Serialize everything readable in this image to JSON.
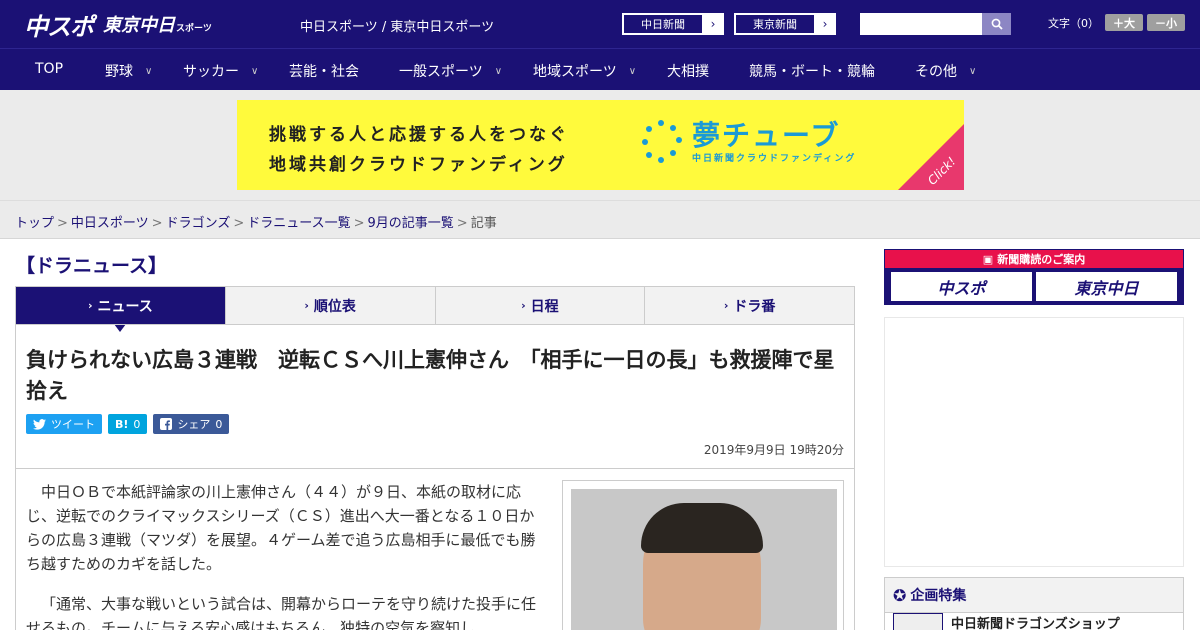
{
  "header": {
    "logo_main": "中スポ",
    "logo_tokyo": "東京中日",
    "logo_tokyo_small": "スポーツ",
    "site_links": "中日スポーツ / 東京中日スポーツ",
    "paper_buttons": [
      {
        "label": "中日新聞",
        "arrow": "›"
      },
      {
        "label": "東京新聞",
        "arrow": "›"
      }
    ],
    "search_placeholder": "",
    "fontsize_label": "文字（0）",
    "fontsize_up": "＋大",
    "fontsize_down": "－小"
  },
  "nav": {
    "items": [
      {
        "label": "TOP",
        "chev": ""
      },
      {
        "label": "野球",
        "chev": "∨"
      },
      {
        "label": "サッカー",
        "chev": "∨"
      },
      {
        "label": "芸能・社会",
        "chev": ""
      },
      {
        "label": "一般スポーツ",
        "chev": "∨"
      },
      {
        "label": "地域スポーツ",
        "chev": "∨"
      },
      {
        "label": "大相撲",
        "chev": ""
      },
      {
        "label": "競馬・ボート・競輪",
        "chev": ""
      },
      {
        "label": "その他",
        "chev": "∨"
      }
    ]
  },
  "banner": {
    "line1": "挑戦する人と応援する人をつなぐ",
    "line2": "地域共創クラウドファンディング",
    "brand": "夢チューブ",
    "brand_sub": "中日新聞クラウドファンディング",
    "click": "Click!"
  },
  "breadcrumb": {
    "items": [
      "トップ",
      "中日スポーツ",
      "ドラゴンズ",
      "ドラニュース一覧",
      "9月の記事一覧"
    ],
    "current": "記事",
    "sep": ">"
  },
  "main": {
    "section_title": "【ドラニュース】",
    "tabs": [
      {
        "label": "ニュース",
        "mark": "›"
      },
      {
        "label": "順位表",
        "mark": "›"
      },
      {
        "label": "日程",
        "mark": "›"
      },
      {
        "label": "ドラ番",
        "mark": "›"
      }
    ],
    "headline": "負けられない広島３連戦　逆転ＣＳへ川上憲伸さん　「相手に一日の長」も救援陣で星拾え",
    "social": {
      "tweet": "ツイート",
      "hatena": "B!",
      "hatena_count": "0",
      "share": "シェア",
      "share_count": "0"
    },
    "date": "2019年9月9日 19時20分",
    "paragraphs": [
      "中日ＯＢで本紙評論家の川上憲伸さん（４４）が９日、本紙の取材に応じ、逆転でのクライマックスシリーズ（ＣＳ）進出へ大一番となる１０日からの広島３連戦（マツダ）を展望。４ゲーム差で追う広島相手に最低でも勝ち越すためのカギを話した。",
      "「通常、大事な戦いという試合は、開幕からローテを守り続けた投手に任せるもの。チームに与える安心感はもちろん、独特の空気を察知し"
    ]
  },
  "sidebar": {
    "subscribe_title": "新聞購読のご案内",
    "subscribe_logos": [
      "中スポ",
      "東京中日"
    ],
    "feature_title": "企画特集",
    "feature_item": "中日新聞ドラゴンズショップ"
  },
  "colors": {
    "brand_navy": "#1b1175",
    "banner_yellow": "#fffa3c",
    "accent_blue": "#1a9ad6",
    "accent_pink": "#e8386d",
    "subscribe_red": "#e8114b",
    "twitter": "#1da1f2",
    "hatena": "#00a4de",
    "facebook": "#3b5998"
  }
}
